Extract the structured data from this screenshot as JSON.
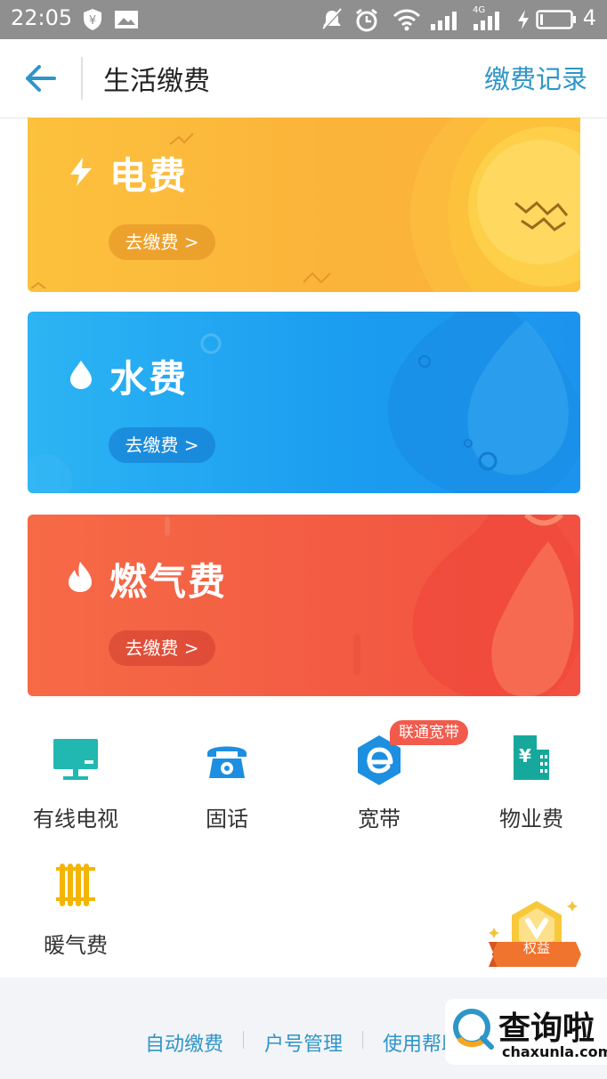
{
  "status_bar": {
    "time": "22:05",
    "battery": "4",
    "network": "4G"
  },
  "header": {
    "title": "生活缴费",
    "records_label": "缴费记录"
  },
  "cards": [
    {
      "label": "电费",
      "button": "去缴费 >",
      "icon": "lightning-icon",
      "color": "#fbb43a"
    },
    {
      "label": "水费",
      "button": "去缴费 >",
      "icon": "water-drop-icon",
      "color": "#1b9cf0"
    },
    {
      "label": "燃气费",
      "button": "去缴费 >",
      "icon": "flame-icon",
      "color": "#f35b43"
    }
  ],
  "services": [
    {
      "label": "有线电视",
      "icon": "tv-icon"
    },
    {
      "label": "固话",
      "icon": "telephone-icon"
    },
    {
      "label": "宽带",
      "icon": "broadband-e-icon",
      "tag": "联通宽带"
    },
    {
      "label": "物业费",
      "icon": "building-yen-icon"
    },
    {
      "label": "暖气费",
      "icon": "radiator-icon"
    }
  ],
  "badge": {
    "text": "权益"
  },
  "footer": {
    "links": [
      "自动缴费",
      "户号管理",
      "使用帮助"
    ]
  },
  "watermark": {
    "text": "查询啦",
    "sub": "chaxunla.com"
  },
  "colors": {
    "accent": "#2e95c9",
    "tag_red": "#f25a4c"
  }
}
